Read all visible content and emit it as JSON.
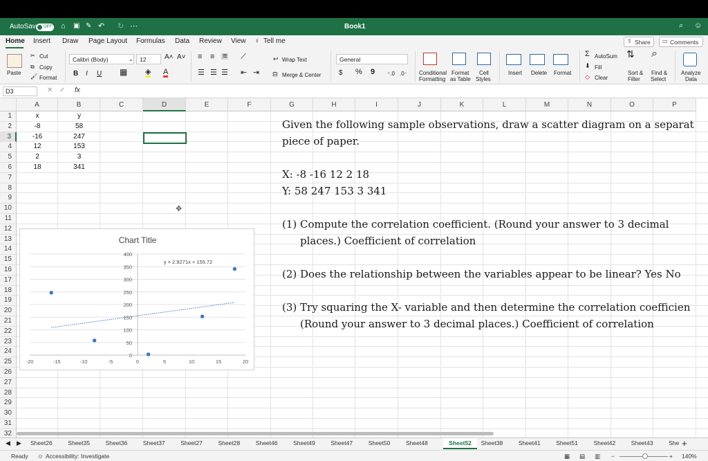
{
  "titlebar": {
    "autosave_label": "AutoSave",
    "autosave_state": "OFF",
    "workbook": "Book1"
  },
  "menu": [
    "Home",
    "Insert",
    "Draw",
    "Page Layout",
    "Formulas",
    "Data",
    "Review",
    "View",
    "Tell me"
  ],
  "share_label": "Share",
  "comments_label": "Comments",
  "ribbon": {
    "paste": "Paste",
    "cut": "Cut",
    "copy": "Copy",
    "format": "Format",
    "font_name": "Calibri (Body)",
    "font_size": "12",
    "bold": "B",
    "italic": "I",
    "underline": "U",
    "wrap_text": "Wrap Text",
    "merge_center": "Merge & Center",
    "number_format": "General",
    "currency": "$",
    "percent": "%",
    "comma": "9",
    "cond_format_1": "Conditional",
    "cond_format_2": "Formatting",
    "format_table_1": "Format",
    "format_table_2": "as Table",
    "cell_styles_1": "Cell",
    "cell_styles_2": "Styles",
    "insert": "Insert",
    "delete": "Delete",
    "format_cells": "Format",
    "autosum": "AutoSum",
    "fill": "Fill",
    "clear": "Clear",
    "sort_filter_1": "Sort &",
    "sort_filter_2": "Filter",
    "find_select_1": "Find &",
    "find_select_2": "Select",
    "analyze_1": "Analyze",
    "analyze_2": "Data"
  },
  "formula_bar": {
    "name_box": "D3",
    "fx": "fx",
    "value": ""
  },
  "columns": [
    "A",
    "B",
    "C",
    "D",
    "E",
    "F",
    "G",
    "H",
    "I",
    "J",
    "K",
    "L",
    "M",
    "N",
    "O",
    "P"
  ],
  "rows": [
    "1",
    "2",
    "3",
    "4",
    "5",
    "6",
    "7",
    "8",
    "9",
    "10",
    "11",
    "12",
    "13",
    "14",
    "15",
    "16",
    "17",
    "18",
    "19",
    "20",
    "21",
    "22",
    "23",
    "24",
    "25",
    "26",
    "27",
    "28",
    "29",
    "30",
    "31",
    "32"
  ],
  "cells": {
    "A1": "x",
    "B1": "y",
    "A2": "-8",
    "B2": "58",
    "A3": "-16",
    "B3": "247",
    "A4": "12",
    "B4": "153",
    "A5": "2",
    "B5": "3",
    "A6": "18",
    "B6": "341"
  },
  "note": {
    "line1": "Given the following sample observations, draw a scatter diagram on a separat",
    "line2": "piece of paper.",
    "line3": "X: -8 -16 12 2 18",
    "line4": "Y: 58 247 153 3 341",
    "line5": "(1) Compute the correlation coefficient. (Round your answer to 3 decimal",
    "line6": "places.) Coefficient of correlation",
    "line7": "(2)  Does the relationship between the variables appear to be linear? Yes No",
    "line8": "(3) Try squaring the X- variable and then determine the correlation coefficien",
    "line9": "(Round your answer to 3 decimal places.) Coefficient of correlation"
  },
  "chart_data": {
    "type": "scatter",
    "title": "Chart Title",
    "x": [
      -8,
      -16,
      12,
      2,
      18
    ],
    "y": [
      58,
      247,
      153,
      3,
      341
    ],
    "xlim": [
      -20,
      20
    ],
    "ylim": [
      0,
      400
    ],
    "xticks": [
      -20,
      -15,
      -10,
      -5,
      0,
      5,
      10,
      15,
      20
    ],
    "yticks": [
      0,
      50,
      100,
      150,
      200,
      250,
      300,
      350,
      400
    ],
    "trendline": {
      "slope": 2.9271,
      "intercept": 155.72,
      "label": "y = 2.9271x + 155.72",
      "x_range": [
        -16,
        18
      ]
    },
    "grid": "horizontal",
    "point_color": "#4472c4"
  },
  "sheets": [
    "Sheet26",
    "Sheet35",
    "Sheet36",
    "Sheet37",
    "Sheet27",
    "Sheet28",
    "Sheet46",
    "Sheet49",
    "Sheet47",
    "Sheet50",
    "Sheet48",
    "Sheet52",
    "Sheet38",
    "Sheet41",
    "Sheet51",
    "Sheet42",
    "Sheet43",
    "She"
  ],
  "active_sheet": "Sheet52",
  "status": {
    "ready": "Ready",
    "accessibility": "Accessibility: Investigate",
    "zoom": "140%"
  },
  "colors": {
    "accent": "#1e7145",
    "series": "#4472c4"
  }
}
